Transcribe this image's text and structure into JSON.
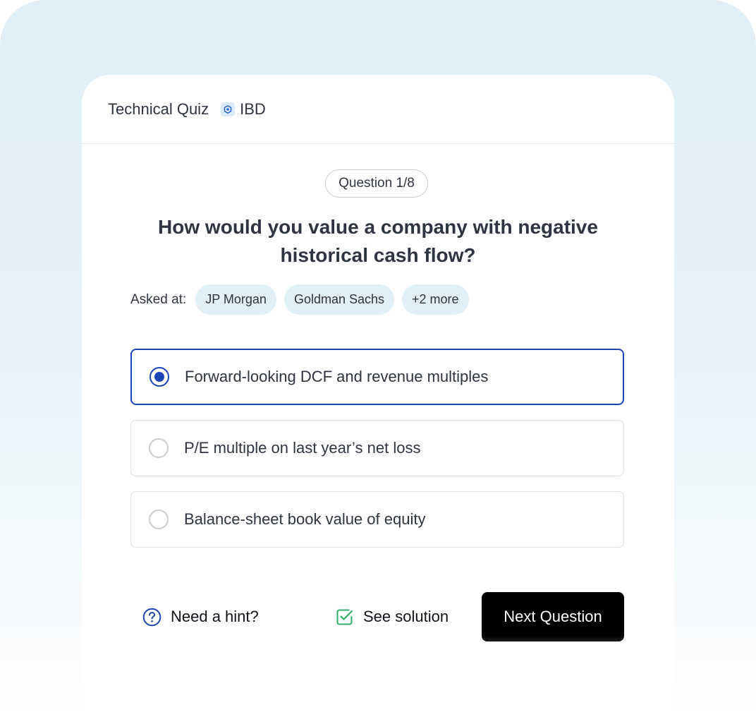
{
  "header": {
    "title": "Technical Quiz",
    "tag_label": "IBD",
    "tag_icon": "ibd-icon"
  },
  "question": {
    "counter": "Question 1/8",
    "text": "How would you value a company with negative historical cash flow?"
  },
  "asked_at": {
    "label": "Asked at:",
    "chips": [
      "JP Morgan",
      "Goldman Sachs",
      "+2 more"
    ]
  },
  "options": [
    {
      "label": "Forward-looking DCF and revenue multiples",
      "selected": true
    },
    {
      "label": "P/E multiple on last year’s net loss",
      "selected": false
    },
    {
      "label": "Balance-sheet book value of equity",
      "selected": false
    }
  ],
  "footer": {
    "hint_label": "Need a hint?",
    "hint_icon": "question-circle-icon",
    "solution_label": "See solution",
    "solution_icon": "check-square-icon",
    "next_label": "Next Question"
  },
  "colors": {
    "accent": "#1b45b4",
    "success": "#2fae6a",
    "chip_bg": "#e1eff6",
    "primary_button": "#000000"
  }
}
